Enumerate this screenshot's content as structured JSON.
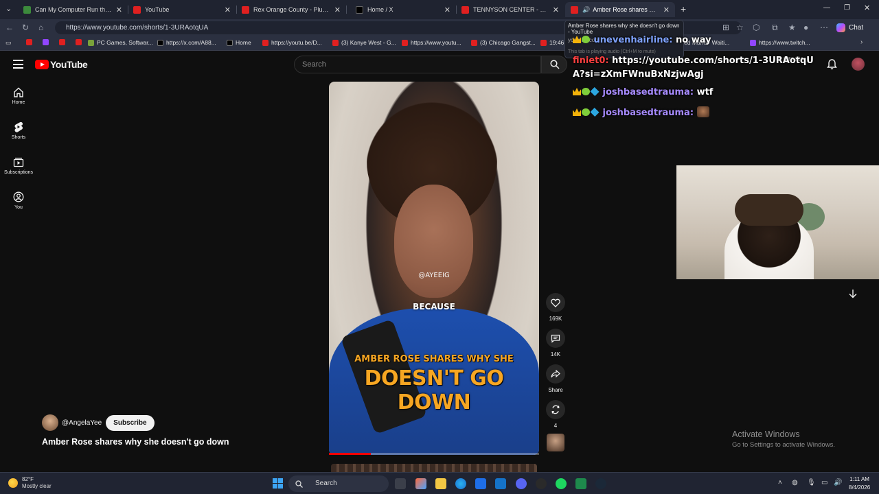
{
  "browser": {
    "tabs": [
      {
        "title": "Can My Computer Run these gam",
        "icon": "generic-favicon"
      },
      {
        "title": "YouTube",
        "icon": "youtube-favicon"
      },
      {
        "title": "Rex Orange County - Pluto Project",
        "icon": "youtube-favicon"
      },
      {
        "title": "Home / X",
        "icon": "x-favicon"
      },
      {
        "title": "TENNYSON CENTER - YouTube",
        "icon": "youtube-favicon"
      },
      {
        "title": "Amber Rose shares why she d",
        "icon": "youtube-favicon"
      }
    ],
    "new_tab_label": "+",
    "url": "https://www.youtube.com/shorts/1-3URAotqUA",
    "chat_label": "Chat",
    "bookmarks": [
      {
        "label": ""
      },
      {
        "label": ""
      },
      {
        "label": ""
      },
      {
        "label": "PC Games, Softwar..."
      },
      {
        "label": "https://x.com/A88..."
      },
      {
        "label": "Home"
      },
      {
        "label": "https://youtu.be/D..."
      },
      {
        "label": "(3) Kanye West - G..."
      },
      {
        "label": "https://www.youtu..."
      },
      {
        "label": "(3) Chicago Gangst..."
      },
      {
        "label": "19:46"
      },
      {
        "label": "ed Mario - Waiti..."
      },
      {
        "label": "https://www.twitch..."
      }
    ],
    "tooltip": {
      "title": "Amber Rose shares why she doesn't go down - YouTube",
      "domain": "youtube.com",
      "note": "This tab is playing audio (Ctrl+M to mute)"
    }
  },
  "youtube": {
    "logo_text": "YouTube",
    "search_placeholder": "Search",
    "create_label": "+ Create",
    "sidebar": [
      {
        "label": "Home",
        "icon": "home-icon"
      },
      {
        "label": "Shorts",
        "icon": "shorts-icon"
      },
      {
        "label": "Subscriptions",
        "icon": "subscriptions-icon"
      },
      {
        "label": "You",
        "icon": "you-icon"
      }
    ],
    "video_captions": {
      "watermark": "@AYEEIG",
      "word": "BECAUSE",
      "headline_top": "AMBER ROSE SHARES WHY SHE",
      "headline_bottom": "DOESN'T GO DOWN"
    },
    "progress_fraction": 0.2,
    "actions": {
      "likes": "169K",
      "comments": "14K",
      "share": "Share",
      "remix": "4"
    },
    "channel": {
      "handle": "@AngelaYee",
      "subscribe": "Subscribe"
    },
    "title": "Amber Rose shares why she doesn't go down"
  },
  "overlay_chat": [
    {
      "user": "unevenhairline:",
      "text": "no way",
      "user_color": "#7fa3ff"
    },
    {
      "user": "finiet0:",
      "text": "https://youtube.com/shorts/1-3URAotqUA?si=zXmFWnuBxNzjwAgj",
      "user_color": "#ff4040"
    },
    {
      "user": "joshbasedtrauma:",
      "text": "wtf",
      "user_color": "#a78bff"
    },
    {
      "user": "joshbasedtrauma:",
      "text": "",
      "user_color": "#a78bff"
    }
  ],
  "windows_watermark": {
    "line1": "Activate Windows",
    "line2": "Go to Settings to activate Windows."
  },
  "taskbar": {
    "weather_temp": "82°F",
    "weather_desc": "Mostly clear",
    "search_label": "Search",
    "time": "1:11 AM",
    "date": "8/4/2026"
  }
}
